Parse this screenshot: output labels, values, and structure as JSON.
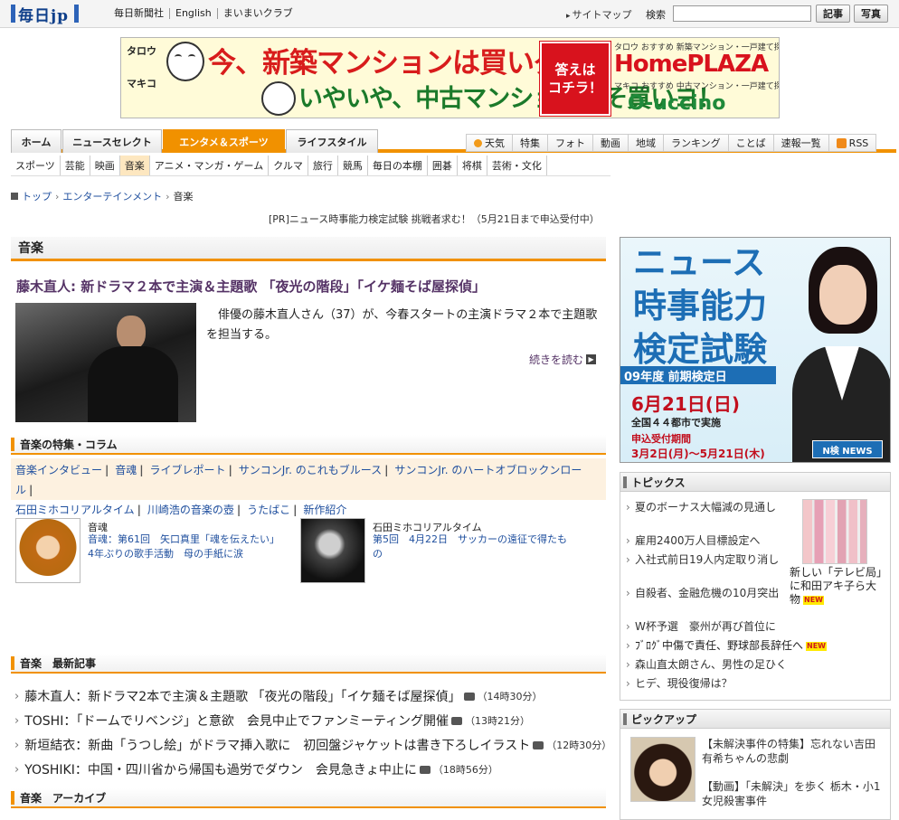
{
  "header": {
    "logo": "毎日jp",
    "links": [
      "毎日新聞社",
      "English",
      "まいまいクラブ"
    ],
    "sitemap": "サイトマップ",
    "search_label": "検索",
    "search_value": "",
    "btn_kiji": "記事",
    "btn_shashin": "写真"
  },
  "banner": {
    "tag1": "タロウ",
    "tag2": "マキコ",
    "line1": "今、新築マンションは買いダ！",
    "line2": "いやいや、中古マンションこそ買いヨ！",
    "button_line1": "答えは",
    "button_line2": "コチラ！",
    "hp_note": "タロウ おすすめ 新築マンション・一戸建て探しは",
    "hp_brand": "HomePLAZA",
    "uc_note": "マキコ おすすめ 中古マンション・一戸建て探しは",
    "uc_brand": "O-uccino"
  },
  "nav": {
    "main": [
      "ホーム",
      "ニュースセレクト",
      "エンタメ＆スポーツ",
      "ライフスタイル"
    ],
    "right": [
      "天気",
      "特集",
      "フォト",
      "動画",
      "地域",
      "ランキング",
      "ことば",
      "速報一覧",
      "RSS"
    ],
    "genres": [
      "スポーツ",
      "芸能",
      "映画",
      "音楽",
      "アニメ・マンガ・ゲーム",
      "クルマ",
      "旅行",
      "競馬",
      "毎日の本棚",
      "囲碁",
      "将棋",
      "芸術・文化"
    ]
  },
  "breadcrumb": {
    "top": "トップ",
    "mid": "エンターテインメント",
    "current": "音楽"
  },
  "pr_text": "[PR]ニュース時事能力検定試験 挑戦者求む！（5月21日まで申込受付中）",
  "section_title": "音楽",
  "lead": {
    "headline": "藤木直人: 新ドラマ２本で主演＆主題歌 「夜光の階段」「イケ麺そば屋探偵」",
    "text": "俳優の藤木直人さん（37）が、今春スタートの主演ドラマ２本で主題歌を担当する。",
    "more": "続きを読む"
  },
  "features": {
    "title": "音楽の特集・コラム",
    "links": [
      "音楽インタビュー",
      "音魂",
      "ライブレポート",
      "サンコンJr. のこれもブルース",
      "サンコンJr. のハートオブロックンロール",
      "石田ミホコリアルタイム",
      "川崎浩の音楽の壺",
      "うたばこ",
      "新作紹介"
    ],
    "item1": {
      "cat": "音魂",
      "desc": "音魂：第61回　矢口真里「魂を伝えたい」 4年ぶりの歌手活動　母の手紙に涙"
    },
    "item2": {
      "cat": "石田ミホコリアルタイム",
      "desc": "第5回　4月22日　サッカーの遠征で得たもの"
    }
  },
  "latest": {
    "title": "音楽　最新記事",
    "items": [
      {
        "text": "藤木直人：新ドラマ2本で主演＆主題歌 「夜光の階段」「イケ麺そば屋探偵」",
        "time": "（14時30分）"
      },
      {
        "text": "TOSHI：「ドームでリベンジ」と意欲　会見中止でファンミーティング開催",
        "time": "（13時21分）"
      },
      {
        "text": "新垣結衣：新曲「うつし絵」がドラマ挿入歌に　初回盤ジャケットは書き下ろしイラスト",
        "time": "（12時30分）"
      },
      {
        "text": "YOSHIKI：中国・四川省から帰国も過労でダウン　会見急きょ中止に",
        "time": "（18時56分）"
      }
    ]
  },
  "archive_title": "音楽　アーカイブ",
  "ad": {
    "title1": "ニュース",
    "title2": "時事能力",
    "title3": "検定試験",
    "band": "09年度 前期検定日",
    "date": "6月21日(日)",
    "cities": "全国４４都市で実施",
    "apply": "申込受付期間",
    "period": "3月2日(月)〜5月21日(木)",
    "logo": "N検 NEWS"
  },
  "topics": {
    "title": "トピックス",
    "items": [
      "夏のボーナス大幅減の見通し",
      "雇用2400万人目標設定へ",
      "入社式前日19人内定取り消し",
      "自殺者、金融危機の10月突出",
      "W杯予選　豪州が再び首位に",
      "ﾌﾞﾛｸﾞ中傷で責任、野球部長辞任へ",
      "森山直太朗さん、男性の足ひく",
      "ヒデ、現役復帰は？"
    ],
    "photo_caption": "新しい「テレビ局」に和田アキ子ら大物",
    "new_badge": "NEW"
  },
  "pickup": {
    "title": "ピックアップ",
    "items": [
      "【未解決事件の特集】忘れない吉田有希ちゃんの悲劇",
      "【動画】「未解決」を歩く 栃木・小1女児殺害事件"
    ]
  }
}
